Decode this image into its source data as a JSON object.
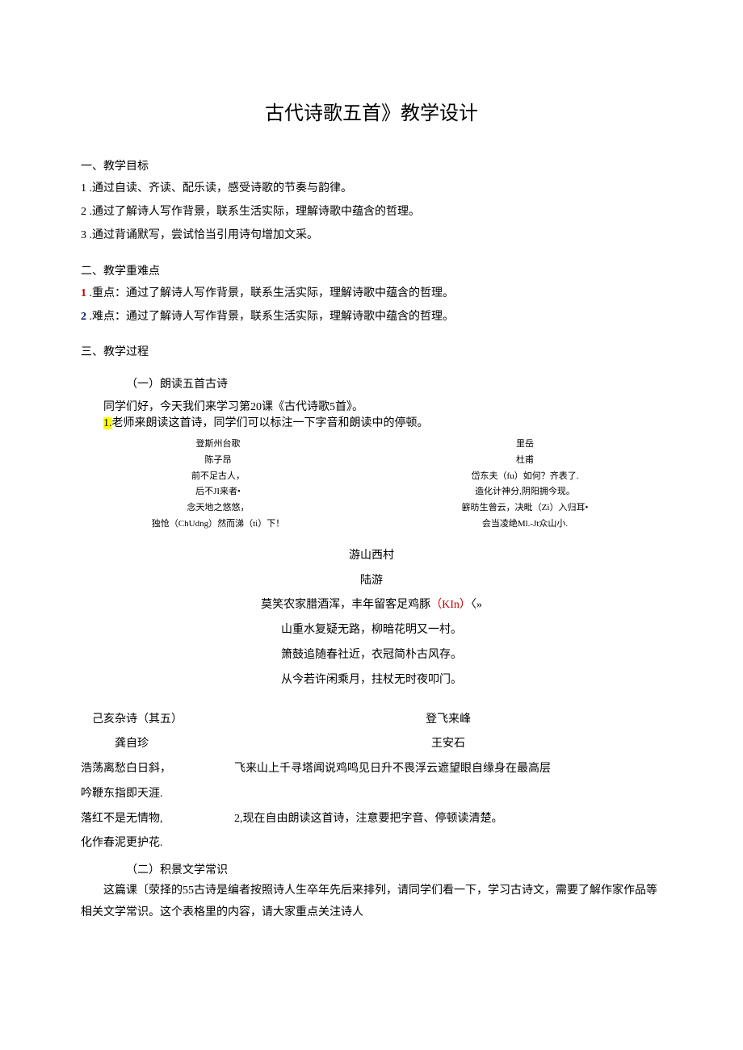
{
  "title": "古代诗歌五首》教学设计",
  "sec1_head": "一、教学目标",
  "sec1_1": "1 .通过自读、齐读、配乐读，感受诗歌的节奏与韵律。",
  "sec1_2": "2 .通过了解诗人写作背景，联系生活实际，理解诗歌中蕴含的哲理。",
  "sec1_3": "3 .通过背诵默写，尝试恰当引用诗句增加文采。",
  "sec2_head": "二、教学重难点",
  "sec2_1_num": "1",
  "sec2_1_body": " .重点：通过了解诗人写作背景，联系生活实际，理解诗歌中蕴含的哲理。",
  "sec2_2_num": "2",
  "sec2_2_body": " .难点：通过了解诗人写作背景，联系生活实际，理解诗歌中蕴含的哲理。",
  "sec3_head": "三、教学过程",
  "sec3_1_title": "（一）朗读五首古诗",
  "sec3_intro": "同学们好，今天我们来学习第20课《古代诗歌5首》。",
  "sec3_1_num": "1.",
  "sec3_1_body": "老师来朗读这首诗，同学们可以标注一下字音和朗读中的停顿。",
  "poem_left": {
    "t": "登斯州台歌",
    "a": "陈子昂",
    "l1": "前不足古人，",
    "l2": "后不JI来者•",
    "l3": "念天地之悠悠，",
    "l4": "独怆（ChUdng）然而涕（ti）下！"
  },
  "poem_right": {
    "t": "里岳",
    "a": "杜甫",
    "l1": "岱东夫（fu）如何？齐表了.",
    "l2": "造化计神分,阴阳拥今现。",
    "l3": "簖昉生曾云，决毗（Zi）入归耳•",
    "l4": "会当凌绝Ml.-Jt众山小."
  },
  "poem_center": {
    "t": "游山西村",
    "a": "陆游",
    "l1_a": "莫笑农家腊酒浑，丰年留客足鸡豚",
    "l1_pinyin": "（KIn）",
    "l1_b": "〈»",
    "l2": "山重水复疑无路，柳暗花明又一村。",
    "l3": "箫鼓追随春社近，衣冠简朴古风存。",
    "l4": "从今若许闲乘月，拄杖无时夜叩门。"
  },
  "left_col": {
    "t": "己亥杂诗（其五）",
    "a": "龚自珍",
    "l1": "浩荡离愁白日斜，",
    "l2": "吟鞭东指即天涯.",
    "l3": "落红不是无情物,",
    "l4": "化作春泥更护花."
  },
  "right_col": {
    "t": "登飞来峰",
    "a": "王安石",
    "line": "飞来山上千寻塔闻说鸡鸣见日升不畏浮云遮望眼自缘身在最高层"
  },
  "sec3_2_body": "2,现在自由朗读这首诗，注意要把字音、停顿读清楚。",
  "sec3_2_title": "（二）积景文学常识",
  "para_final": "这篇课〔荥择的55古诗是编者按照诗人生卒年先后来排列，请同学们看一下，学习古诗文，需要了解作家作品等相关文学常识。这个表格里的内容，请大家重点关注诗人"
}
